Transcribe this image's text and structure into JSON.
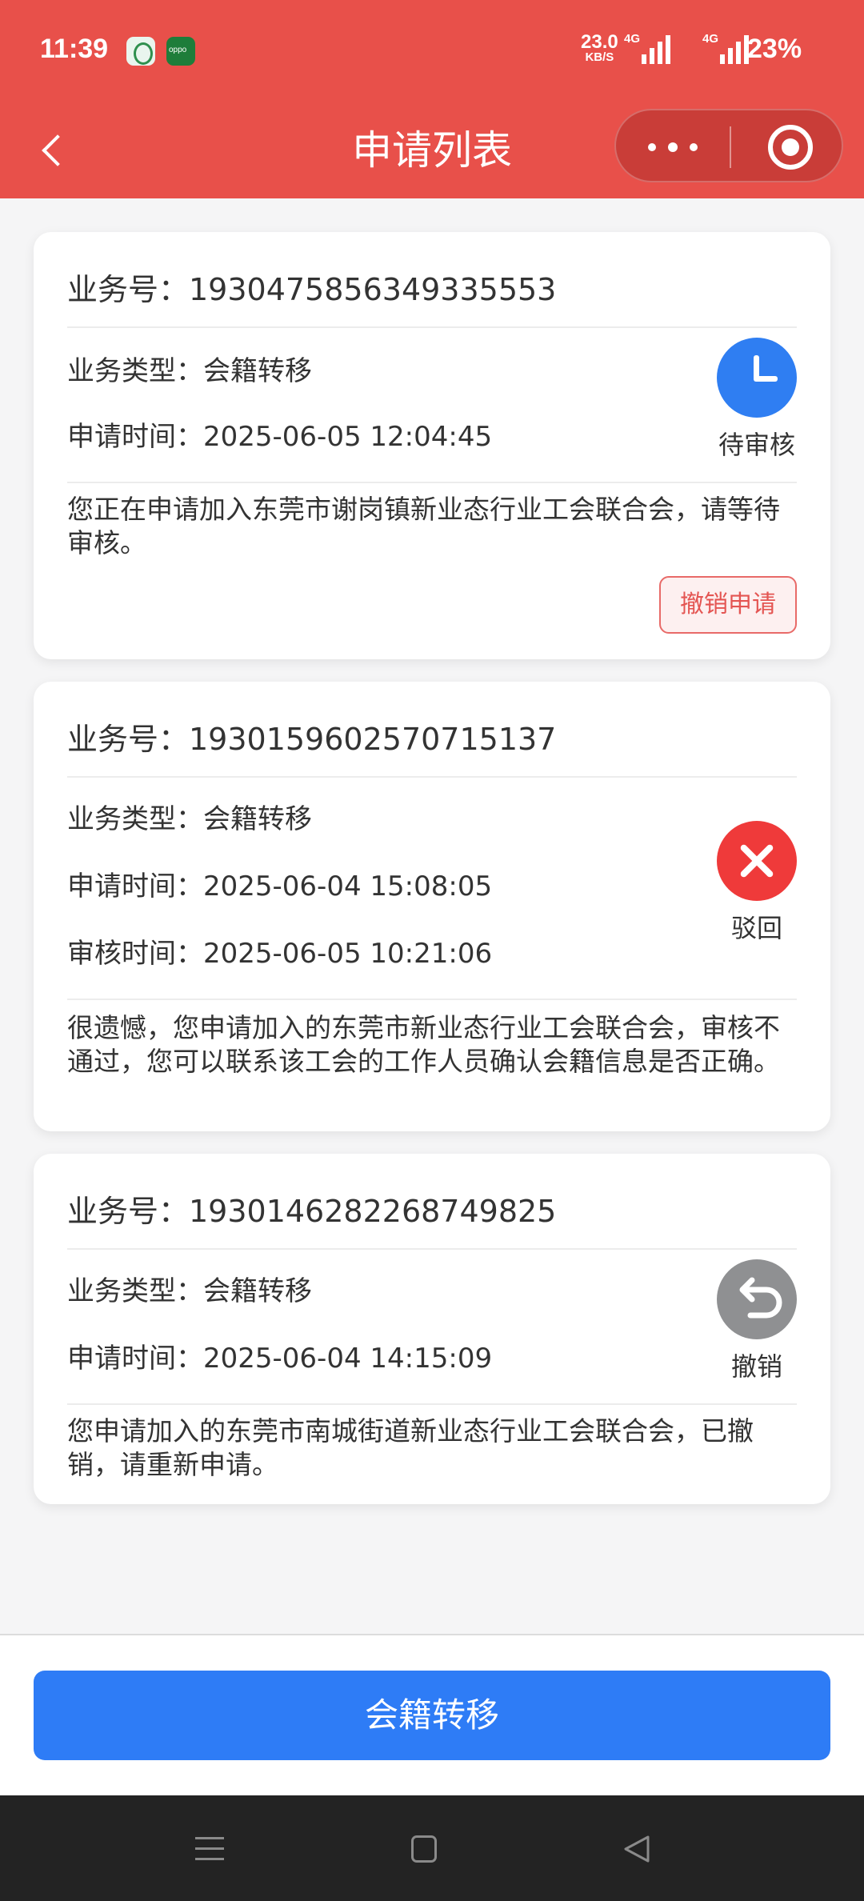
{
  "status_bar": {
    "time": "11:39",
    "net_speed": "23.0",
    "net_unit": "KB/S",
    "sim1": "4G",
    "sim2": "4G",
    "battery": "23%"
  },
  "header": {
    "title": "申请列表",
    "back_icon": "chevron-left-icon",
    "more_icon": "more-dots-icon",
    "close_icon": "target-close-icon",
    "color": "#e8504a"
  },
  "applications": [
    {
      "business_no": "业务号：1930475856349335553",
      "type": "业务类型：会籍转移",
      "apply_time": "申请时间：2025-06-05 12:04:45",
      "status": "待审核",
      "status_icon": "clock-icon",
      "status_color": "#2f7ef2",
      "message": "您正在申请加入东莞市谢岗镇新业态行业工会联合会，请等待审核。",
      "action": "撤销申请"
    },
    {
      "business_no": "业务号：1930159602570715137",
      "type": "业务类型：会籍转移",
      "apply_time": "申请时间：2025-06-04 15:08:05",
      "review_time": "审核时间：2025-06-05 10:21:06",
      "status": "驳回",
      "status_icon": "x-close-icon",
      "status_color": "#ef3a3a",
      "message": "很遗憾，您申请加入的东莞市新业态行业工会联合会，审核不通过，您可以联系该工会的工作人员确认会籍信息是否正确。"
    },
    {
      "business_no": "业务号：1930146282268749825",
      "type": "业务类型：会籍转移",
      "apply_time": "申请时间：2025-06-04 14:15:09",
      "status": "撤销",
      "status_icon": "undo-arrow-icon",
      "status_color": "#8f9092",
      "message": "您申请加入的东莞市南城街道新业态行业工会联合会，已撤销，请重新申请。"
    }
  ],
  "bottom_button": {
    "label": "会籍转移",
    "color": "#2e7cf6"
  },
  "system_nav": {
    "icons": [
      "menu-icon",
      "home-square-icon",
      "back-triangle-icon"
    ]
  }
}
